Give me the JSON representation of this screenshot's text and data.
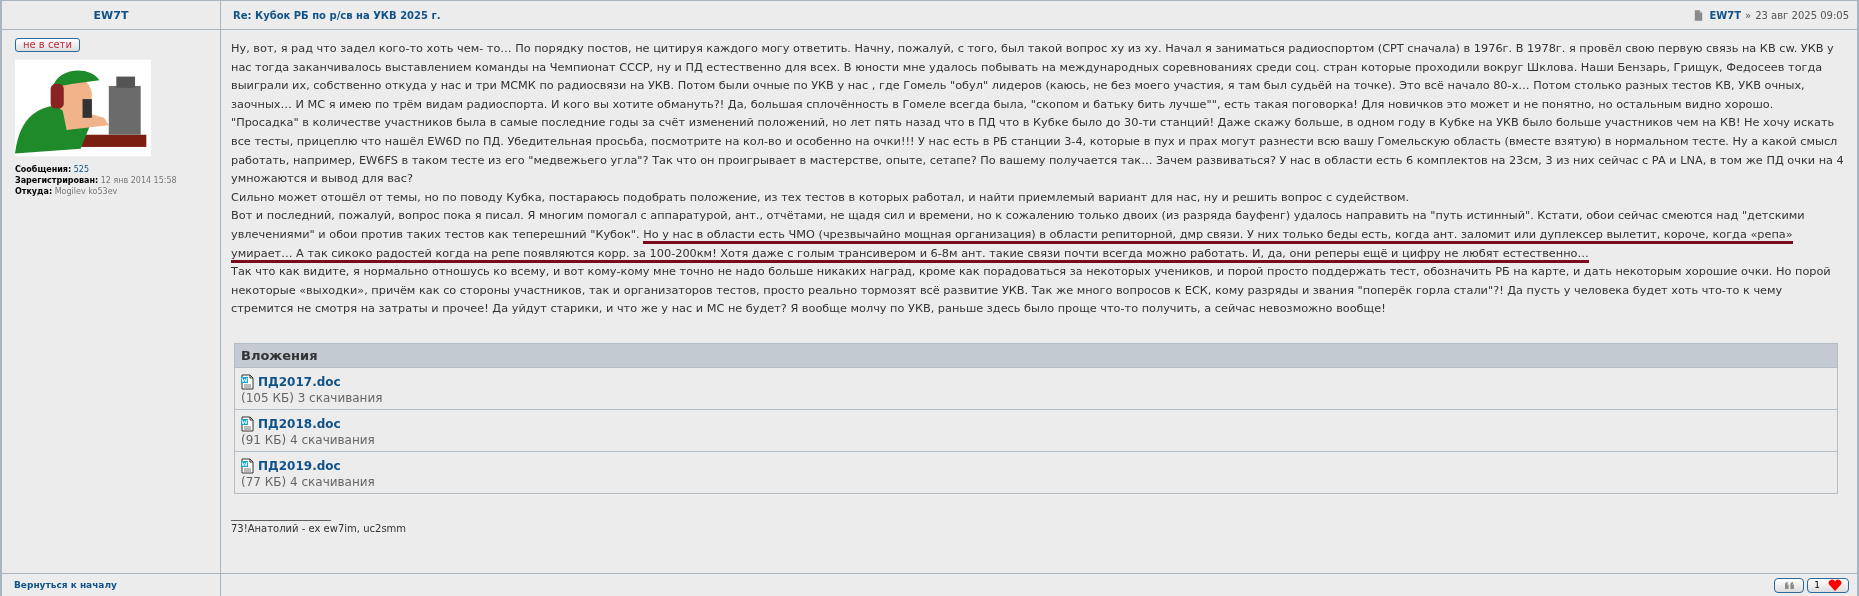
{
  "profile_header": {
    "username": "EW7T"
  },
  "post_header": {
    "title": "Re: Кубок РБ по р/св на УКВ 2025 г.",
    "author": "EW7T",
    "separator": "»",
    "date": "23 авг 2025 09:05"
  },
  "profile": {
    "status": "не в сети",
    "online": false,
    "fields": [
      {
        "label": "Сообщения:",
        "value": "525",
        "kind": "link"
      },
      {
        "label": "Зарегистрирован:",
        "value": "12 янв 2014 15:58",
        "kind": "text"
      },
      {
        "label": "Откуда:",
        "value": "Mogilev ko53ev",
        "kind": "text"
      }
    ]
  },
  "body": {
    "paragraphs": [
      {
        "segments": [
          {
            "text": "Ну, вот, я рад что задел кого-то хоть чем- то… По порядку постов, не цитируя каждого могу ответить. Начну, пожалуй, с того, был такой вопрос ху из ху. Начал я заниматься радиоспортом (СРТ сначала) в 1976г. В 1978г. я провёл свою первую связь на КВ cw. УКВ у нас тогда заканчивалось выставлением команды на Чемпионат СССР, ну и ПД естественно для всех. В юности мне удалось побывать на международных соревнованиях среди соц. стран которые проходили вокруг Шклова. Наши Бензарь, Грищук, Федосеев тогда выиграли их, собственно откуда у нас и три МСМК по радиосвязи на УКВ. Потом были очные по УКВ у нас , где Гомель \"обул\" лидеров (каюсь, не без моего участия, я там был судьёй на точке). Это всё начало 80-х… Потом столько разных тестов КВ, УКВ очных, заочных… И МС я имею по трём видам радиоспорта. И кого вы хотите обмануть?! Да, большая сплочённость в Гомеле всегда была, \"скопом и батьку бить лучше\"\", есть такая поговорка! Для новичков это может и не понятно, но остальным видно хорошо.",
            "underlined": false
          }
        ]
      },
      {
        "segments": [
          {
            "text": "\"Просадка\" в количестве участников была в самые последние годы за счёт изменений положений, но лет пять назад что в ПД что в Кубке было до 30-ти станций! Даже скажу больше, в одном году в Кубке на УКВ было больше участников чем на КВ! Не хочу искать все тесты, прицеплю что нашёл EW6D по ПД. Убедительная просьба, посмотрите на кол-во и особенно на очки!!! У нас есть в РБ станции 3-4, которые в пух и прах могут разнести всю вашу Гомельскую область (вместе взятую) в нормальном тесте. Ну а какой смысл работать, например, EW6FS в таком тесте из его \"медвежьего угла\"? Так что он проигрывает в мастерстве, опыте, сетапе? По вашему получается так… Зачем развиваться? У нас в области есть 6 комплектов на 23см, 3 из них сейчас с PA и LNA, в том же ПД очки на 4 умножаются и вывод для вас?",
            "underlined": false
          }
        ]
      },
      {
        "segments": [
          {
            "text": "Сильно может отошёл от темы, но по поводу Кубка, постараюсь подобрать положение, из тех тестов в которых работал, и найти приемлемый вариант для нас, ну и решить вопрос с судейством.",
            "underlined": false
          }
        ]
      },
      {
        "segments": [
          {
            "text": "Вот и последний, пожалуй, вопрос пока я писал. Я многим помогал с аппаратурой, ант., отчётами, не щадя сил и времени, но к сожалению только двоих (из разряда бауфенг) удалось направить на \"путь истинный\". Кстати, обои сейчас смеются над \"детскими увлечениями\" и обои против таких тестов как теперешний \"Кубок\". ",
            "underlined": false
          },
          {
            "text": "Но у нас в области есть ЧМО (чрезвычайно мощная организация) в области репиторной, дмр связи. У них только беды есть, когда ант. заломит или дуплексер вылетит, короче, когда «репа» умирает… А так сикоко радостей когда на репе появляются корр. за 100-200км! Хотя даже с голым трансивером и 6-8м ант. такие связи почти всегда можно работать. И, да, они реперы ещё и цифру не любят естественно…",
            "underlined": true
          }
        ]
      },
      {
        "segments": [
          {
            "text": "Так что как видите, я нормально отношусь ко всему, и вот кому-кому мне точно не надо больше никаких наград, кроме как порадоваться за некоторых учеников, и порой просто поддержать тест, обозначить РБ на карте, и дать некоторым хорошие очки. Но порой некоторые «выходки», причём как со стороны участников, так и организаторов тестов, просто реально тормозят всё развитие УКВ. Так же много вопросов к ЕСК, кому разряды и звания \"поперёк горла стали\"?! Да пусть у человека будет хоть что-то к чему стремится не смотря на затраты и прочее! Да уйдут старики, и что же у нас и МС не будет? Я вообще молчу по УКВ, раньше здесь было проще что-то получить, а сейчас невозможно вообще!",
            "underlined": false
          }
        ]
      }
    ]
  },
  "attachments": {
    "title": "Вложения",
    "files": [
      {
        "name": "ПД2017.doc",
        "info": "(105 КБ) 3 скачивания"
      },
      {
        "name": "ПД2018.doc",
        "info": "(91 КБ) 4 скачивания"
      },
      {
        "name": "ПД2019.doc",
        "info": "(77 КБ) 4 скачивания"
      }
    ]
  },
  "signature": {
    "rule": "____________________",
    "text": "73!Анатолий - ex ew7im, uc2smm"
  },
  "footer": {
    "back_link": "Вернуться к началу",
    "like_count": "1"
  }
}
